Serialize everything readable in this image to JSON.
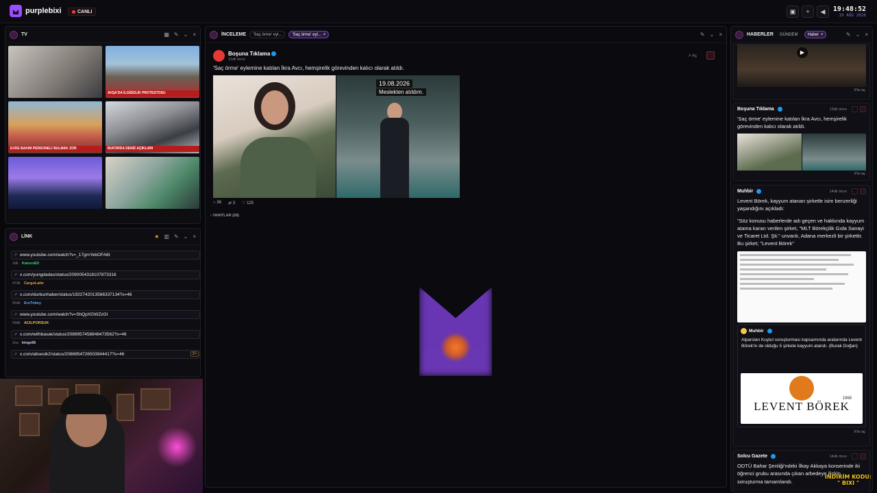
{
  "topbar": {
    "brand": "purplebixi",
    "live_label": "CANLI",
    "clock_time": "19:48:52",
    "clock_date": "19 AĞU 2026"
  },
  "tv_panel": {
    "title": "TV",
    "tickers": [
      "EVDE BAKIM PERSONELİ BULMAK ZOR",
      "BUFORDA DENİZ AÇIKLARI",
      "AVŞA'DA İLGİSİZLİK PROTESTOSU"
    ]
  },
  "link_panel": {
    "title": "LİNK",
    "items": [
      {
        "url": "www.youtube.com/watch?v=_17gmYebOFA6t",
        "age": "3dk",
        "user": "KaizenED"
      },
      {
        "url": "x.com/yungdadas/status/2090054318107873316",
        "age": "47dk",
        "user": "CargoLatte"
      },
      {
        "url": "x.com/durbunhaber/status/1922742013566337134?s=46",
        "age": "56dk",
        "user": "ErsTnbey"
      },
      {
        "url": "www.youtube.com/watch?v=ShQpXGWZzGI",
        "age": "58dk",
        "user": "ACILPORSUK"
      },
      {
        "url": "x.com/withbasak/status/2089957458848473562?s=46",
        "age": "3sa",
        "user": "kingx66"
      },
      {
        "url": "x.com/abseslk2/status/2086954726503944417?s=46",
        "age": "",
        "user": "",
        "badge": "2×"
      }
    ]
  },
  "review_panel": {
    "title": "İNCELEME",
    "chips": [
      "'Saç örme' eyl...",
      "'Saç örme' eyl..."
    ],
    "post": {
      "author": "Boşuna Tıklama",
      "time": "11dk önce",
      "text": "'Saç örme' eylemine katılan İkra Avcı, hemşirelik görevinden kalıcı olarak atıldı.",
      "image_date": "19.08.2026",
      "image_caption": "Meslekten atıldım.",
      "replies": "36",
      "reposts": "3",
      "likes": "125",
      "open_label": "Aç"
    },
    "replies_label": "YANITLAR (28)"
  },
  "news_panel": {
    "title": "HABERLER",
    "tabs": [
      "GÜNDEM",
      "Haber"
    ],
    "open_label": "X'te aç",
    "cards": [
      {
        "source": "Boşuna Tıklama",
        "time": "13dk önce",
        "text": "'Saç örme' eylemine katılan İkra Avcı, hemşirelik görevinden kalıcı olarak atıldı."
      },
      {
        "source": "Muhbir",
        "time": "14dk önce",
        "text": "Levent Börek, kayyum atanan şirketle isim benzerliği yaşandığını açıkladı:",
        "quote": "\"Söz konusu haberlerde adı geçen ve hakkında kayyum atama kararı verilen şirket, \"MLT Börekçilik Gıda Sanayi ve Ticaret Ltd. Şti.\" unvanlı, Adana merkezli bir şirkettir. Bu şirket; \"Levent Börek\""
      },
      {
        "source": "Muhbir",
        "time": "",
        "text": "Alparslan Kuytul soruşturması kapsamında aralarında Levent Börek'in de olduğu 5 şirkete kayyum atandı. (Burak Doğan)",
        "logo_text": "LEVENT BÖREK",
        "logo_year": "1968"
      },
      {
        "source": "Solcu Gazete",
        "time": "14dk önce",
        "text": "ODTÜ Bahar Şenliği'ndeki İlkay Akkaya konserinde iki öğrenci grubu arasında çıkan arbedeye ilişkin soruşturma tamamlandı."
      }
    ]
  },
  "overlay": {
    "promo_line1": "İNDİRİM KODU:",
    "promo_line2": "\" BIXI \""
  },
  "colors": {
    "accent": "#9b4dff",
    "live_red": "#ff3b3b",
    "verified": "#1d9bf0"
  }
}
